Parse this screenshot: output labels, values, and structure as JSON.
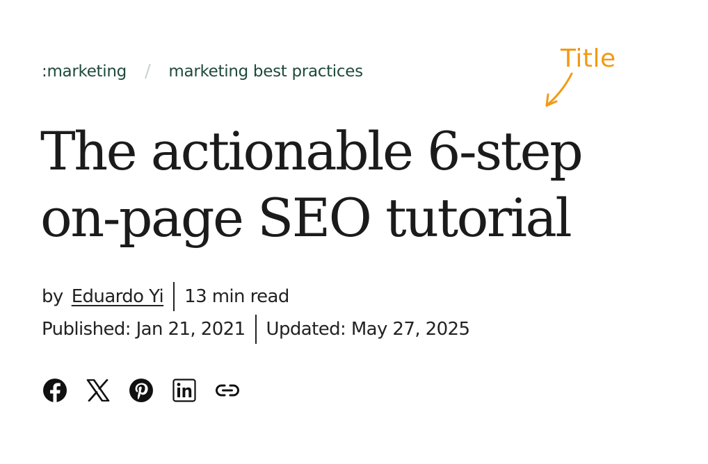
{
  "breadcrumb": {
    "items": [
      {
        "label": ":marketing"
      },
      {
        "label": "marketing best practices"
      }
    ],
    "separator": "/"
  },
  "annotation": {
    "label": "Title",
    "color": "#f29a14"
  },
  "article": {
    "title": "The actionable 6-step on-page SEO tutorial",
    "by_label": "by",
    "author": "Eduardo Yi",
    "read_time": "13 min read",
    "published": "Published: Jan 21, 2021",
    "updated": "Updated: May 27, 2025"
  },
  "share": {
    "icons": [
      "facebook-icon",
      "x-icon",
      "pinterest-icon",
      "linkedin-icon",
      "link-icon"
    ]
  },
  "colors": {
    "breadcrumb": "#1e4a3b",
    "text": "#1f1f1f",
    "annotation": "#f29a14"
  }
}
